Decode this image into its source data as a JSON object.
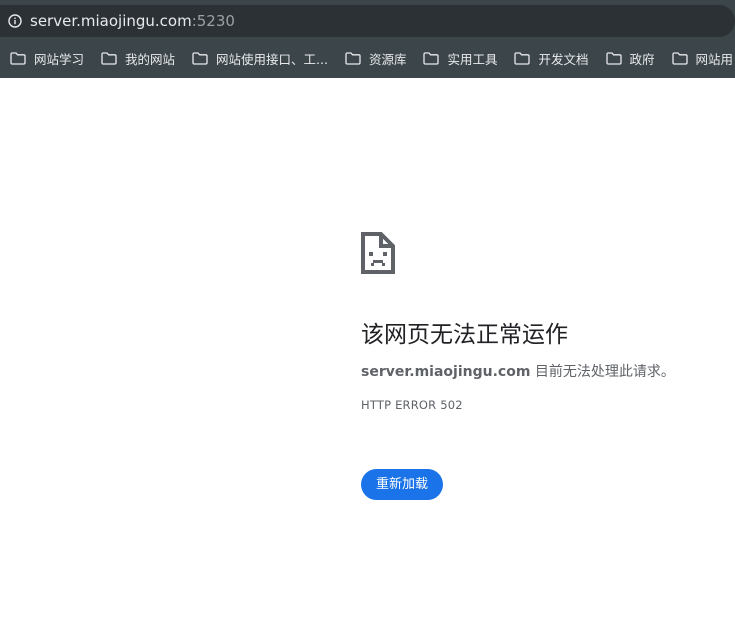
{
  "address_bar": {
    "host": "server.miaojingu.com",
    "port": ":5230"
  },
  "bookmarks": [
    {
      "label": "网站学习"
    },
    {
      "label": "我的网站"
    },
    {
      "label": "网站使用接口、工..."
    },
    {
      "label": "资源库"
    },
    {
      "label": "实用工具"
    },
    {
      "label": "开发文档"
    },
    {
      "label": "政府"
    },
    {
      "label": "网站用"
    }
  ],
  "error_page": {
    "title": "该网页无法正常运作",
    "host": "server.miaojingu.com",
    "message": " 目前无法处理此请求。",
    "error_code": "HTTP ERROR 502",
    "reload_label": "重新加载"
  },
  "colors": {
    "toolbar_bg": "#3c4549",
    "omnibox_bg": "#2b3134",
    "button_blue": "#1a73e8",
    "title_text": "#202124",
    "secondary_text": "#5f6368"
  }
}
